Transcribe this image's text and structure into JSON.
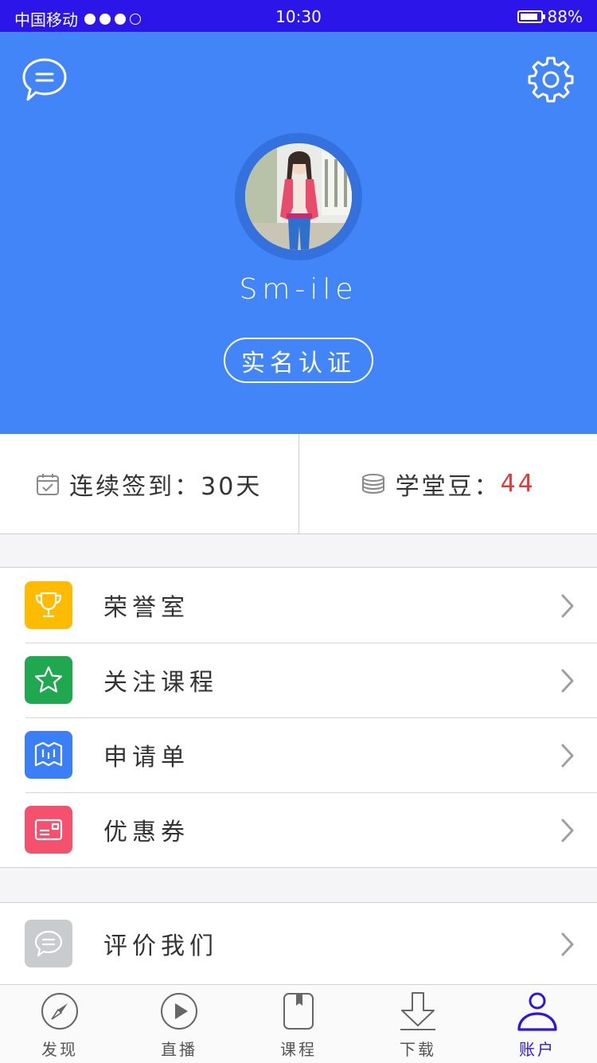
{
  "status_bar": {
    "carrier": "中国移动",
    "signal_bars": 4,
    "signal_filled": 3,
    "time": "10:30",
    "battery_percent": "88%",
    "battery_level": 0.88
  },
  "header": {
    "background_color": "#4285f9",
    "username": "Sm-ile",
    "verify_label": "实名认证"
  },
  "stats": {
    "checkin_label": "连续签到：",
    "checkin_value": "30天",
    "beans_label": "学堂豆：",
    "beans_value": "44"
  },
  "menu": [
    {
      "label": "荣誉室",
      "icon": "trophy-icon",
      "color": "#ffbb00"
    },
    {
      "label": "关注课程",
      "icon": "star-icon",
      "color": "#1fa84f"
    },
    {
      "label": "申请单",
      "icon": "map-icon",
      "color": "#3a7ff5"
    },
    {
      "label": "优惠券",
      "icon": "coupon-icon",
      "color": "#f5506d"
    }
  ],
  "menu2": [
    {
      "label": "评价我们",
      "icon": "comment-icon",
      "color": "#c9cbcf"
    }
  ],
  "tabs": [
    {
      "label": "发现",
      "icon": "compass-icon"
    },
    {
      "label": "直播",
      "icon": "play-icon"
    },
    {
      "label": "课程",
      "icon": "book-icon"
    },
    {
      "label": "下载",
      "icon": "download-icon"
    },
    {
      "label": "账户",
      "icon": "user-icon",
      "active": true
    }
  ],
  "colors": {
    "accent": "#2b15e8",
    "red": "#e53935"
  }
}
